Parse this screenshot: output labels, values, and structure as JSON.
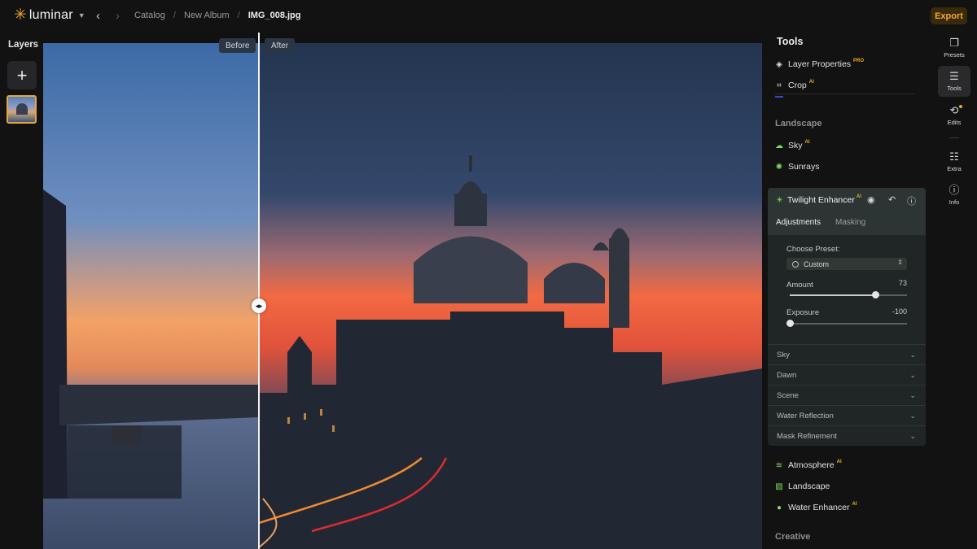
{
  "app": {
    "name": "luminar",
    "logo_icon": "star-icon"
  },
  "breadcrumb": {
    "items": [
      "Catalog",
      "New Album",
      "IMG_008.jpg"
    ]
  },
  "toolbar": {
    "export_label": "Export",
    "accent": "#f0a92a"
  },
  "layers": {
    "title": "Layers",
    "add_icon": "+"
  },
  "compare": {
    "before_label": "Before",
    "after_label": "After"
  },
  "tools": {
    "title": "Tools",
    "essentials": [
      {
        "label": "Layer Properties",
        "tag": "PRO"
      },
      {
        "label": "Crop",
        "tag": "AI"
      }
    ],
    "landscape_title": "Landscape",
    "landscape_items": [
      {
        "label": "Sky",
        "tag": "AI"
      },
      {
        "label": "Sunrays",
        "tag": ""
      }
    ],
    "twilight": {
      "title": "Twilight Enhancer",
      "tag": "AI",
      "tabs": [
        "Adjustments",
        "Masking"
      ],
      "preset_label": "Choose Preset:",
      "preset_value": "Custom",
      "amount_label": "Amount",
      "amount_value": "73",
      "amount_fraction": 0.73,
      "exposure_label": "Exposure",
      "exposure_value": "-100",
      "exposure_fraction": 0.0,
      "sections": [
        "Sky",
        "Dawn",
        "Scene",
        "Water Reflection",
        "Mask Refinement"
      ]
    },
    "more_items": [
      {
        "label": "Atmosphere",
        "tag": "AI"
      },
      {
        "label": "Landscape",
        "tag": ""
      },
      {
        "label": "Water Enhancer",
        "tag": "AI"
      }
    ],
    "creative_title": "Creative"
  },
  "rail": {
    "items": [
      {
        "label": "Presets",
        "icon": "presets-icon"
      },
      {
        "label": "Tools",
        "icon": "sliders-icon"
      },
      {
        "label": "Edits",
        "icon": "history-icon"
      },
      {
        "label": "Extra",
        "icon": "list-icon"
      },
      {
        "label": "Info",
        "icon": "info-icon"
      }
    ]
  }
}
